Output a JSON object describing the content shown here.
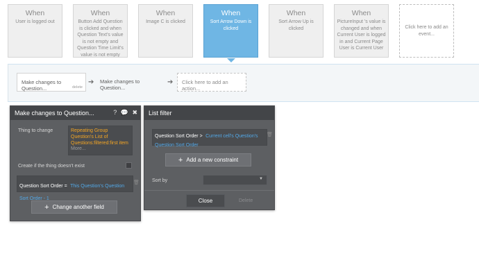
{
  "events": [
    {
      "title": "When",
      "body": "User is logged out"
    },
    {
      "title": "When",
      "body": "Button Add Question is clicked and when Question Text's value is not empty and Question Time Limit's value is not empty"
    },
    {
      "title": "When",
      "body": "Image C is clicked"
    },
    {
      "title": "When",
      "body": "Sort Arrow Down is clicked"
    },
    {
      "title": "When",
      "body": "Sort Arrow Up is clicked"
    },
    {
      "title": "When",
      "body": "PictureInput 's value is changed and when Current User is logged in and Current Page User is Current User"
    }
  ],
  "add_event_label": "Click here to add an event...",
  "actions": {
    "first": "Make changes to Question...",
    "first_delete": "delete",
    "second": "Make changes to Question...",
    "add": "Click here to add an action..."
  },
  "panel_make_changes": {
    "title": "Make changes to Question...",
    "thing_to_change_label": "Thing to change",
    "thing_to_change_value": "Repeating Group Question's List of Questions:filtered:first item",
    "more_label": "More...",
    "create_label": "Create if the thing doesn't exist",
    "field_name": "Question Sort Order =",
    "field_value": "This Question's Question Sort Order - 1",
    "change_another_button": "Change another field"
  },
  "panel_list_filter": {
    "title": "List filter",
    "constraint_field": "Question Sort Order >",
    "constraint_value": "Current cell's Question's Question Sort Order",
    "add_constraint_button": "Add a new constraint",
    "sort_by_label": "Sort by",
    "sort_by_value": "",
    "close_button": "Close",
    "delete_button": "Delete"
  },
  "icons": {
    "help": "help-icon",
    "comment": "comment-icon",
    "close": "close-icon",
    "trash": "trash-icon",
    "arrow": "arrow-right-icon",
    "plus": "plus-icon",
    "chevron": "chevron-down-icon"
  },
  "colors": {
    "active_event": "#6fb6e4",
    "panel": "#5d5f62",
    "orange_text": "#f5a623",
    "blue_text": "#53a9e8"
  }
}
